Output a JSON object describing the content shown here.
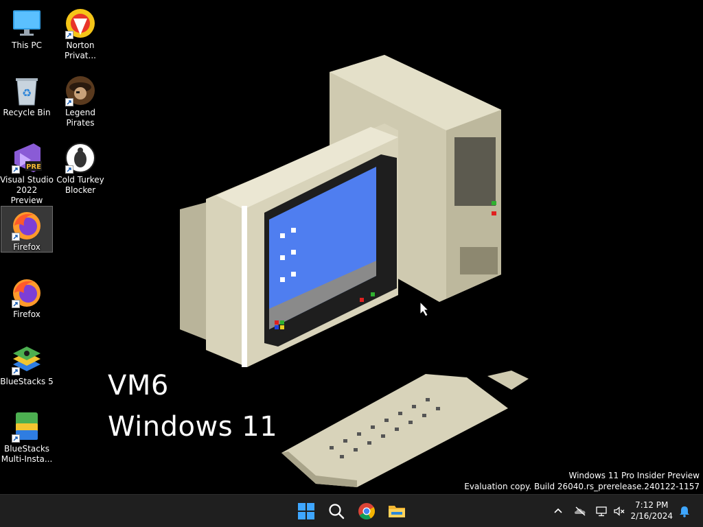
{
  "desktop_icons": [
    {
      "label": "This PC",
      "icon": "this-pc-icon",
      "shortcut": false,
      "selected": false
    },
    {
      "label": "Recycle Bin",
      "icon": "recycle-bin-icon",
      "shortcut": false,
      "selected": false
    },
    {
      "label": "Visual Studio\n2022 Preview",
      "icon": "visual-studio-icon",
      "shortcut": true,
      "selected": false
    },
    {
      "label": "Firefox",
      "icon": "firefox-icon",
      "shortcut": true,
      "selected": true
    },
    {
      "label": "Firefox",
      "icon": "firefox-icon",
      "shortcut": true,
      "selected": false
    },
    {
      "label": "BlueStacks 5",
      "icon": "bluestacks-icon",
      "shortcut": true,
      "selected": false
    },
    {
      "label": "BlueStacks\nMulti-Insta...",
      "icon": "bluestacks-multi-icon",
      "shortcut": true,
      "selected": false
    },
    {
      "label": "Norton\nPrivat...",
      "icon": "norton-icon",
      "shortcut": true,
      "selected": false
    },
    {
      "label": "Legend\nPirates",
      "icon": "legend-pirates-icon",
      "shortcut": true,
      "selected": false
    },
    {
      "label": "Cold Turkey\nBlocker",
      "icon": "cold-turkey-icon",
      "shortcut": true,
      "selected": false
    }
  ],
  "wallpaper": {
    "line1": "VM6",
    "line2": "Windows 11"
  },
  "watermark": {
    "line1": "Windows 11 Pro Insider Preview",
    "line2": "Evaluation copy. Build 26040.rs_prerelease.240122-1157"
  },
  "taskbar": {
    "pinned": [
      "start-icon",
      "search-icon",
      "chrome-icon",
      "file-explorer-icon"
    ],
    "tray": [
      "chevron-up-icon",
      "onedrive-icon",
      "network-icon",
      "volume-muted-icon"
    ],
    "time": "7:12 PM",
    "date": "2/16/2024"
  },
  "colors": {
    "taskbar_bg": "#1f1f1f",
    "accent": "#0078d4",
    "screen_blue": "#4f7ef0",
    "beige": "#d8d3ba"
  }
}
